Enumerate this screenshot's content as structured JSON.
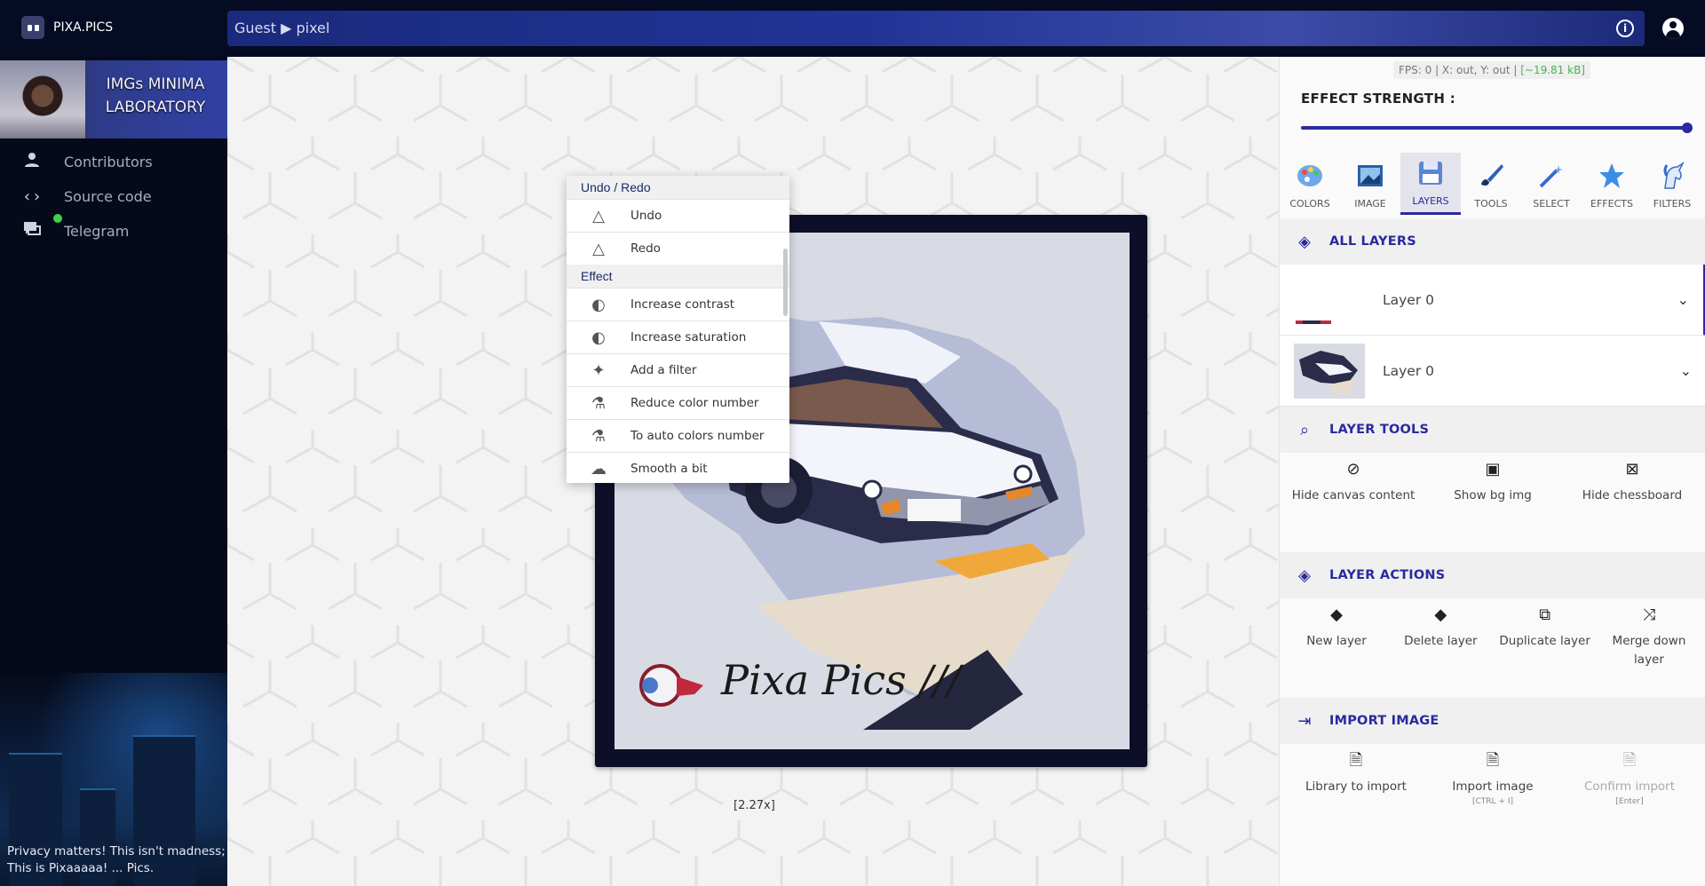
{
  "app": {
    "name": "PIXA.PICS",
    "breadcrumb": "Guest ▶ pixel"
  },
  "sidebar": {
    "lab_title": "IMGs MINIMA LABORATORY",
    "items": [
      {
        "icon": "person-icon",
        "label": "Contributors"
      },
      {
        "icon": "code-icon",
        "label": "Source code"
      },
      {
        "icon": "chat-icon",
        "label": "Telegram"
      }
    ],
    "privacy": "Privacy matters! This isn't madness; This is Pixaaaaa! ... Pics."
  },
  "context_menu": {
    "sections": [
      {
        "title": "Undo / Redo",
        "items": [
          {
            "icon": "triangle-icon",
            "label": "Undo"
          },
          {
            "icon": "triangle-icon",
            "label": "Redo"
          }
        ]
      },
      {
        "title": "Effect",
        "items": [
          {
            "icon": "contrast-icon",
            "label": "Increase contrast"
          },
          {
            "icon": "contrast-icon",
            "label": "Increase saturation"
          },
          {
            "icon": "sparkles-icon",
            "label": "Add a filter"
          },
          {
            "icon": "flask-icon",
            "label": "Reduce color number"
          },
          {
            "icon": "flask-icon",
            "label": "To auto colors number"
          },
          {
            "icon": "cloud-icon",
            "label": "Smooth a bit"
          }
        ]
      }
    ]
  },
  "canvas": {
    "zoom": "[2.27x]",
    "signature": "Pixa Pics ///"
  },
  "panel": {
    "fps_prefix": "FPS: 0 | X: out, Y: out |",
    "fps_size": "[~19.81 kB]",
    "effect_strength_label": "EFFECT STRENGTH :",
    "effect_strength": 1.0,
    "tabs": [
      {
        "label": "COLORS",
        "icon": "palette-icon",
        "active": false
      },
      {
        "label": "IMAGE",
        "icon": "image-icon",
        "active": false
      },
      {
        "label": "LAYERS",
        "icon": "floppy-icon",
        "active": true
      },
      {
        "label": "TOOLS",
        "icon": "brush-icon",
        "active": false
      },
      {
        "label": "SELECT",
        "icon": "wand-icon",
        "active": false
      },
      {
        "label": "EFFECTS",
        "icon": "star-icon",
        "active": false
      },
      {
        "label": "FILTERS",
        "icon": "unicorn-icon",
        "active": false
      }
    ],
    "all_layers_title": "ALL LAYERS",
    "layers": [
      {
        "name": "Layer 0"
      },
      {
        "name": "Layer 0"
      }
    ],
    "layer_tools_title": "LAYER TOOLS",
    "layer_tools": [
      {
        "label": "Hide canvas content",
        "icon": "layers-off-icon"
      },
      {
        "label": "Show bg img",
        "icon": "image-frame-icon"
      },
      {
        "label": "Hide chessboard",
        "icon": "image-off-icon"
      }
    ],
    "layer_actions_title": "LAYER ACTIONS",
    "layer_actions": [
      {
        "label": "New layer",
        "icon": "layer-plus-icon"
      },
      {
        "label": "Delete layer",
        "icon": "layer-minus-icon"
      },
      {
        "label": "Duplicate layer",
        "icon": "duplicate-icon"
      },
      {
        "label": "Merge down layer",
        "icon": "merge-icon"
      }
    ],
    "import_title": "IMPORT IMAGE",
    "import_actions": [
      {
        "label": "Library to import",
        "icon": "file-icon",
        "hint": "",
        "disabled": false
      },
      {
        "label": "Import image",
        "icon": "file-icon",
        "hint": "[CTRL + I]",
        "disabled": false
      },
      {
        "label": "Confirm import",
        "icon": "file-icon",
        "hint": "[Enter]",
        "disabled": true
      }
    ]
  },
  "colors": {
    "accent": "#2a2aa0",
    "topbar": "#050b22",
    "sidebar": "#050a1a"
  }
}
